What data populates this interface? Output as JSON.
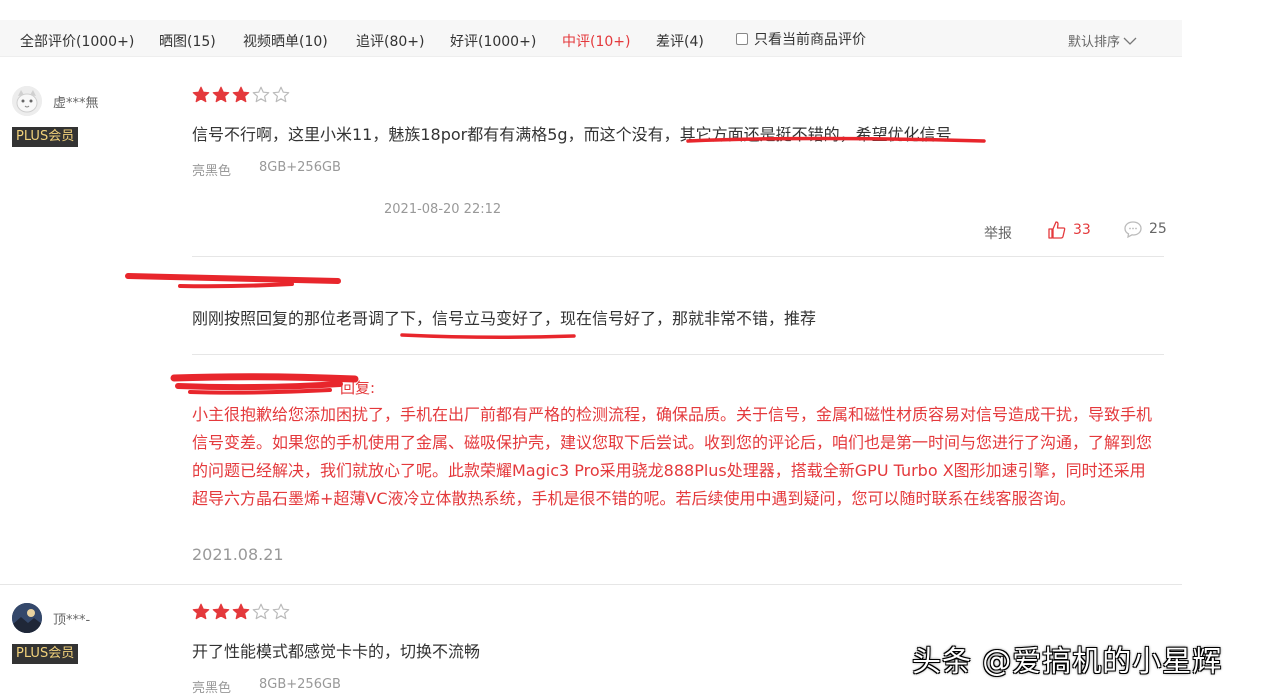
{
  "tabs": [
    {
      "label": "全部评价(1000+)",
      "active": false
    },
    {
      "label": "晒图(15)",
      "active": false
    },
    {
      "label": "视频晒单(10)",
      "active": false
    },
    {
      "label": "追评(80+)",
      "active": false
    },
    {
      "label": "好评(1000+)",
      "active": false
    },
    {
      "label": "中评(10+)",
      "active": true
    },
    {
      "label": "差评(4)",
      "active": false
    }
  ],
  "only_current_label": "只看当前商品评价",
  "sort_label": "默认排序",
  "reviews": [
    {
      "username": "虚***無",
      "badge": "PLUS会员",
      "rating": 3,
      "content": "信号不行啊，这里小米11，魅族18por都有有满格5g，而这个没有，其它方面还是挺不错的，希望优化信号",
      "color": "亮黑色",
      "spec": "8GB+256GB",
      "time": "2021-08-20 22:12",
      "report_label": "举报",
      "likes": "33",
      "comments": "25",
      "followup": "刚刚按照回复的那位老哥调了下，信号立马变好了，现在信号好了，那就非常不错，推荐",
      "merchant_label": "回复:",
      "merchant_reply": "小主很抱歉给您添加困扰了，手机在出厂前都有严格的检测流程，确保品质。关于信号，金属和磁性材质容易对信号造成干扰，导致手机信号变差。如果您的手机使用了金属、磁吸保护壳，建议您取下后尝试。收到您的评论后，咱们也是第一时间与您进行了沟通，了解到您的问题已经解决，我们就放心了呢。此款荣耀Magic3 Pro采用骁龙888Plus处理器，搭载全新GPU Turbo X图形加速引擎，同时还采用超导六方晶石墨烯+超薄VC液冷立体散热系统，手机是很不错的呢。若后续使用中遇到疑问，您可以随时联系在线客服咨询。",
      "reply_date": "2021.08.21"
    },
    {
      "username": "顶***-",
      "badge": "PLUS会员",
      "rating": 3,
      "content": "开了性能模式都感觉卡卡的，切换不流畅",
      "color": "亮黑色",
      "spec": "8GB+256GB"
    }
  ],
  "watermark": "头条 @爱搞机的小星辉",
  "colors": {
    "accent": "#e4393c",
    "badge_bg": "#333333",
    "badge_text": "#f1d17a",
    "annotation": "#e8262c"
  }
}
